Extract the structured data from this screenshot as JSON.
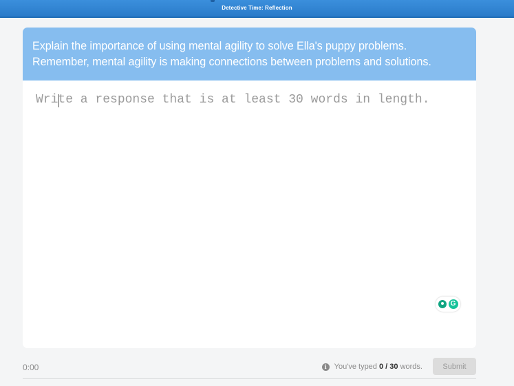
{
  "header": {
    "title": "Detective Time: Reflection",
    "color": "#2f84d2"
  },
  "prompt": {
    "line1": "Explain the importance of using mental agility to solve Ella's puppy problems.",
    "line2": "Remember, mental agility is making connections between problems and solutions.",
    "background": "#86bdef"
  },
  "response": {
    "placeholder": "Write a response that is at least 30 words in length.",
    "value": ""
  },
  "assist_widget": {
    "icons": [
      "lightbulb-icon",
      "grammarly-icon"
    ],
    "g_letter": "G"
  },
  "footer": {
    "timer": "0:00",
    "info_icon_glyph": "i",
    "word_count_prefix": "You've typed ",
    "words_typed": "0",
    "word_count_separator": " / ",
    "words_required": "30",
    "word_count_suffix": " words.",
    "submit_label": "Submit"
  }
}
